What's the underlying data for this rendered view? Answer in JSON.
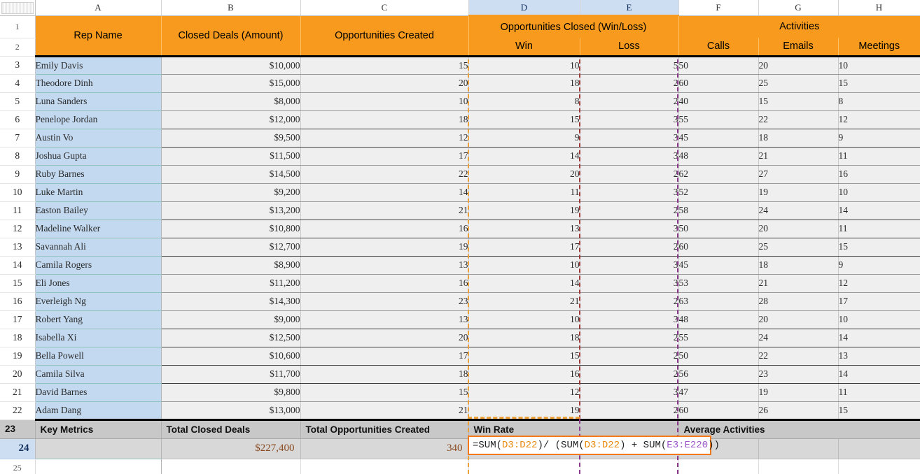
{
  "spreadsheet": {
    "column_letters": [
      "A",
      "B",
      "C",
      "D",
      "E",
      "F",
      "G",
      "H"
    ],
    "selected_columns": [
      "D",
      "E"
    ],
    "active_row": "24",
    "row_numbers": [
      "1",
      "2",
      "3",
      "4",
      "5",
      "6",
      "7",
      "8",
      "9",
      "10",
      "11",
      "12",
      "13",
      "14",
      "15",
      "16",
      "17",
      "18",
      "19",
      "20",
      "21",
      "22",
      "23",
      "24",
      "25"
    ],
    "colors": {
      "header_band": "#f79a1e",
      "name_column": "#c3d9f0",
      "data_cell": "#efefef",
      "key_metrics_row": "#c8c8c8",
      "total_row": "#d8d8d8",
      "selection_highlight": "#cdddf2",
      "formula_border": "#f3791a",
      "dash_d_range": "#eda13a",
      "dash_e_range": "#8b3a8b",
      "total_value_text": "#8a4a20"
    }
  },
  "headers": {
    "group_row": {
      "rep_name": "Rep Name",
      "closed_deals": "Closed Deals (Amount)",
      "opportunities_created": "Opportunities Created",
      "opportunities_closed": "Opportunities Closed (Win/Loss)",
      "activities": "Activities"
    },
    "sub_row": {
      "win": "Win",
      "loss": "Loss",
      "calls": "Calls",
      "emails": "Emails",
      "meetings": "Meetings"
    }
  },
  "rows": [
    {
      "row": "3",
      "name": "Emily Davis",
      "closed": "$10,000",
      "created": "15",
      "win": "10",
      "loss": "5",
      "calls": "50",
      "emails": "20",
      "meetings": "10"
    },
    {
      "row": "4",
      "name": "Theodore Dinh",
      "closed": "$15,000",
      "created": "20",
      "win": "18",
      "loss": "2",
      "calls": "60",
      "emails": "25",
      "meetings": "15"
    },
    {
      "row": "5",
      "name": "Luna Sanders",
      "closed": "$8,000",
      "created": "10",
      "win": "8",
      "loss": "2",
      "calls": "40",
      "emails": "15",
      "meetings": "8"
    },
    {
      "row": "6",
      "name": "Penelope Jordan",
      "closed": "$12,000",
      "created": "18",
      "win": "15",
      "loss": "3",
      "calls": "55",
      "emails": "22",
      "meetings": "12"
    },
    {
      "row": "7",
      "name": "Austin Vo",
      "closed": "$9,500",
      "created": "12",
      "win": "9",
      "loss": "3",
      "calls": "45",
      "emails": "18",
      "meetings": "9"
    },
    {
      "row": "8",
      "name": "Joshua Gupta",
      "closed": "$11,500",
      "created": "17",
      "win": "14",
      "loss": "3",
      "calls": "48",
      "emails": "21",
      "meetings": "11"
    },
    {
      "row": "9",
      "name": "Ruby Barnes",
      "closed": "$14,500",
      "created": "22",
      "win": "20",
      "loss": "2",
      "calls": "62",
      "emails": "27",
      "meetings": "16"
    },
    {
      "row": "10",
      "name": "Luke Martin",
      "closed": "$9,200",
      "created": "14",
      "win": "11",
      "loss": "3",
      "calls": "52",
      "emails": "19",
      "meetings": "10"
    },
    {
      "row": "11",
      "name": "Easton Bailey",
      "closed": "$13,200",
      "created": "21",
      "win": "19",
      "loss": "2",
      "calls": "58",
      "emails": "24",
      "meetings": "14"
    },
    {
      "row": "12",
      "name": "Madeline Walker",
      "closed": "$10,800",
      "created": "16",
      "win": "13",
      "loss": "3",
      "calls": "50",
      "emails": "20",
      "meetings": "11"
    },
    {
      "row": "13",
      "name": "Savannah Ali",
      "closed": "$12,700",
      "created": "19",
      "win": "17",
      "loss": "2",
      "calls": "60",
      "emails": "25",
      "meetings": "15"
    },
    {
      "row": "14",
      "name": "Camila Rogers",
      "closed": "$8,900",
      "created": "13",
      "win": "10",
      "loss": "3",
      "calls": "45",
      "emails": "18",
      "meetings": "9"
    },
    {
      "row": "15",
      "name": "Eli Jones",
      "closed": "$11,200",
      "created": "16",
      "win": "14",
      "loss": "3",
      "calls": "53",
      "emails": "21",
      "meetings": "12"
    },
    {
      "row": "16",
      "name": "Everleigh Ng",
      "closed": "$14,300",
      "created": "23",
      "win": "21",
      "loss": "2",
      "calls": "63",
      "emails": "28",
      "meetings": "17"
    },
    {
      "row": "17",
      "name": "Robert Yang",
      "closed": "$9,000",
      "created": "13",
      "win": "10",
      "loss": "3",
      "calls": "48",
      "emails": "20",
      "meetings": "10"
    },
    {
      "row": "18",
      "name": "Isabella Xi",
      "closed": "$12,500",
      "created": "20",
      "win": "18",
      "loss": "2",
      "calls": "55",
      "emails": "24",
      "meetings": "14"
    },
    {
      "row": "19",
      "name": "Bella Powell",
      "closed": "$10,600",
      "created": "17",
      "win": "15",
      "loss": "2",
      "calls": "50",
      "emails": "22",
      "meetings": "13"
    },
    {
      "row": "20",
      "name": "Camila Silva",
      "closed": "$11,700",
      "created": "18",
      "win": "16",
      "loss": "2",
      "calls": "56",
      "emails": "23",
      "meetings": "14"
    },
    {
      "row": "21",
      "name": "David Barnes",
      "closed": "$9,800",
      "created": "15",
      "win": "12",
      "loss": "3",
      "calls": "47",
      "emails": "19",
      "meetings": "11"
    },
    {
      "row": "22",
      "name": "Adam Dang",
      "closed": "$13,000",
      "created": "21",
      "win": "19",
      "loss": "2",
      "calls": "60",
      "emails": "26",
      "meetings": "15"
    }
  ],
  "summary": {
    "key_metrics_label": "Key Metrics",
    "total_closed_deals_label": "Total Closed Deals",
    "total_opportunities_created_label": "Total Opportunities Created",
    "win_rate_label": "Win Rate",
    "average_activities_label": "Average Activities",
    "total_closed_deals_value": "$227,400",
    "total_opportunities_created_value": "340"
  },
  "formula_editor": {
    "full_text": "=SUM(D3:D22)/ (SUM(D3:D22) + SUM(E3:E220))",
    "tokens": [
      {
        "text": "=SUM(",
        "kind": "plain"
      },
      {
        "text": "D3:D22",
        "kind": "orange"
      },
      {
        "text": ")/ (SUM(",
        "kind": "plain"
      },
      {
        "text": "D3:D22",
        "kind": "orange"
      },
      {
        "text": ") + SUM(",
        "kind": "plain"
      },
      {
        "text": "E3:E220",
        "kind": "purple"
      },
      {
        "text": "))",
        "kind": "plain"
      }
    ]
  }
}
